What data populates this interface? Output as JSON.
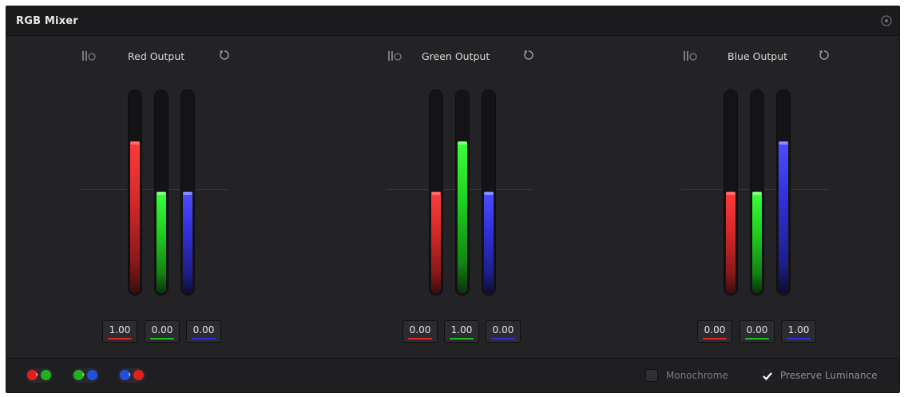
{
  "panel": {
    "title": "RGB Mixer"
  },
  "outputs": [
    {
      "title": "Red Output",
      "channels": [
        {
          "name": "red",
          "value": 1.0,
          "label": "1.00"
        },
        {
          "name": "green",
          "value": 0.0,
          "label": "0.00"
        },
        {
          "name": "blue",
          "value": 0.0,
          "label": "0.00"
        }
      ]
    },
    {
      "title": "Green Output",
      "channels": [
        {
          "name": "red",
          "value": 0.0,
          "label": "0.00"
        },
        {
          "name": "green",
          "value": 1.0,
          "label": "1.00"
        },
        {
          "name": "blue",
          "value": 0.0,
          "label": "0.00"
        }
      ]
    },
    {
      "title": "Blue Output",
      "channels": [
        {
          "name": "red",
          "value": 0.0,
          "label": "0.00"
        },
        {
          "name": "green",
          "value": 0.0,
          "label": "0.00"
        },
        {
          "name": "blue",
          "value": 1.0,
          "label": "1.00"
        }
      ]
    }
  ],
  "slider_range": [
    -2,
    2
  ],
  "footer": {
    "swap_buttons": [
      {
        "icon": "swap-red-green-icon",
        "from": "#e02020",
        "to": "#20b020"
      },
      {
        "icon": "swap-green-blue-icon",
        "from": "#20b020",
        "to": "#2050e0"
      },
      {
        "icon": "swap-blue-red-icon",
        "from": "#2050e0",
        "to": "#e02020"
      }
    ],
    "monochrome": {
      "label": "Monochrome",
      "checked": false
    },
    "preserve_luminance": {
      "label": "Preserve Luminance",
      "checked": true
    }
  },
  "colors": {
    "red": "#e02828",
    "green": "#22c022",
    "blue": "#3030e0",
    "panel_bg": "#232326"
  }
}
